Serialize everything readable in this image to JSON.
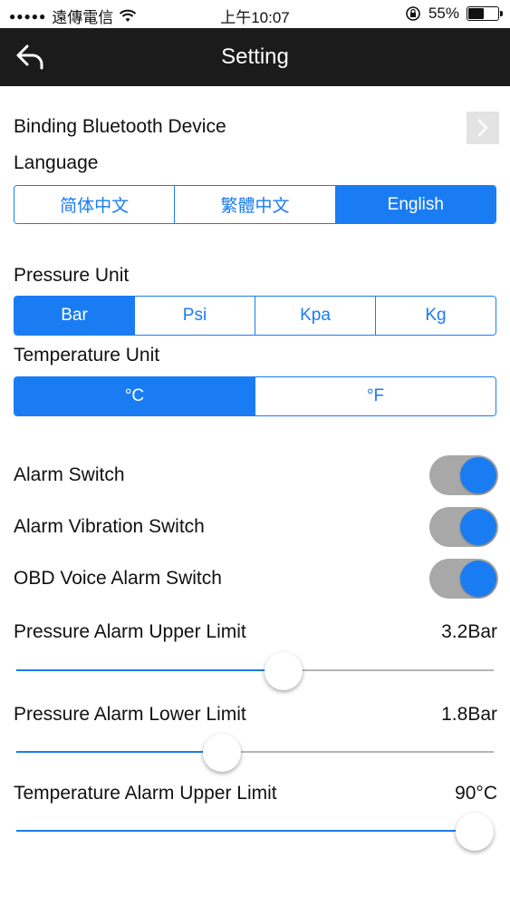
{
  "status_bar": {
    "carrier": "遠傳電信",
    "time": "上午10:07",
    "battery_percent_label": "55%",
    "battery_level": 0.55
  },
  "nav": {
    "title": "Setting",
    "back_icon": "back-arrow-icon"
  },
  "settings": {
    "binding_label": "Binding Bluetooth Device",
    "language_label": "Language",
    "language_options": [
      "简体中文",
      "繁體中文",
      "English"
    ],
    "language_selected": 2,
    "pressure_unit_label": "Pressure Unit",
    "pressure_units": [
      "Bar",
      "Psi",
      "Kpa",
      "Kg"
    ],
    "pressure_selected": 0,
    "temperature_unit_label": "Temperature Unit",
    "temperature_units": [
      "°C",
      "°F"
    ],
    "temperature_selected": 0,
    "alarm_switch_label": "Alarm Switch",
    "alarm_switch_on": true,
    "alarm_vibration_label": "Alarm Vibration Switch",
    "alarm_vibration_on": true,
    "obd_voice_label": "OBD Voice Alarm Switch",
    "obd_voice_on": true,
    "pressure_upper_label": "Pressure Alarm Upper Limit",
    "pressure_upper_value": "3.2Bar",
    "pressure_upper_fraction": 0.56,
    "pressure_lower_label": "Pressure Alarm Lower Limit",
    "pressure_lower_value": "1.8Bar",
    "pressure_lower_fraction": 0.43,
    "temp_upper_label": "Temperature Alarm Upper Limit",
    "temp_upper_value": "90°C",
    "temp_upper_fraction": 0.96
  },
  "colors": {
    "accent": "#1a7cf2",
    "nav_background": "#1b1b1b",
    "toggle_track": "#a8a8a8"
  }
}
